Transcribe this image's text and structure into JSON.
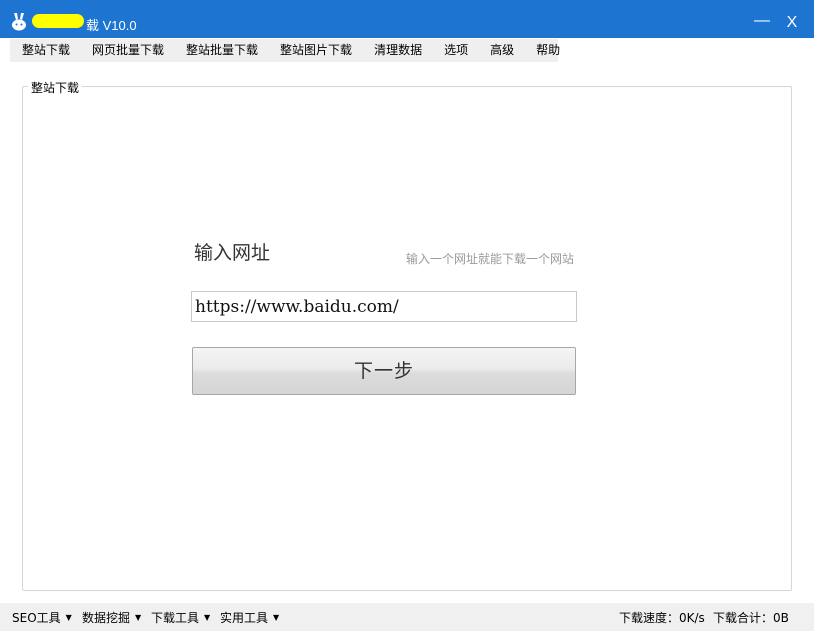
{
  "titlebar": {
    "title_visible_fragment": "载 V10.0",
    "minimize_label": "—",
    "close_label": "X"
  },
  "menu": {
    "items": [
      {
        "label": "整站下载"
      },
      {
        "label": "网页批量下载"
      },
      {
        "label": "整站批量下载"
      },
      {
        "label": "整站图片下载"
      },
      {
        "label": "清理数据"
      },
      {
        "label": "选项"
      },
      {
        "label": "高级"
      },
      {
        "label": "帮助"
      }
    ]
  },
  "panel": {
    "group_title": "整站下载",
    "url_label": "输入网址",
    "url_hint": "输入一个网址就能下载一个网站",
    "url_value": "https://www.baidu.com/",
    "next_button": "下一步"
  },
  "statusbar": {
    "tools": [
      {
        "label": "SEO工具"
      },
      {
        "label": "数据挖掘"
      },
      {
        "label": "下载工具"
      },
      {
        "label": "实用工具"
      }
    ],
    "speed": "下载速度：0K/s",
    "total": "下载合计：0B"
  },
  "colors": {
    "titlebar": "#1d74d1",
    "redaction": "#ffff00"
  }
}
